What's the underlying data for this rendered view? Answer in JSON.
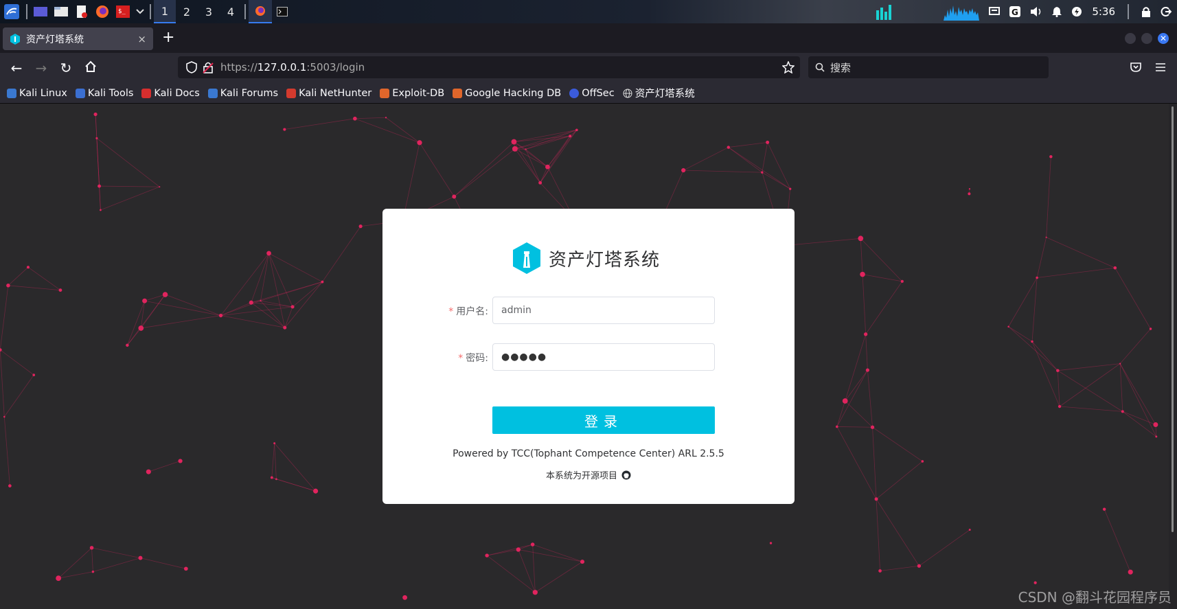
{
  "taskbar": {
    "workspaces": [
      "1",
      "2",
      "3",
      "4"
    ],
    "clock": "5:36"
  },
  "tab": {
    "title": "资产灯塔系统",
    "close": "×",
    "new_tab": "+"
  },
  "nav": {
    "url_prefix": "https://",
    "url_host": "127.0.0.1",
    "url_rest": ":5003/login",
    "search_placeholder": "搜索"
  },
  "bookmarks": [
    {
      "label": "Kali Linux",
      "color": "#3a78d0"
    },
    {
      "label": "Kali Tools",
      "color": "#3b6fd1"
    },
    {
      "label": "Kali Docs",
      "color": "#d62e2e"
    },
    {
      "label": "Kali Forums",
      "color": "#3a78d0"
    },
    {
      "label": "Kali NetHunter",
      "color": "#d33a2e"
    },
    {
      "label": "Exploit-DB",
      "color": "#e0662b"
    },
    {
      "label": "Google Hacking DB",
      "color": "#e0662b"
    },
    {
      "label": "OffSec",
      "color": "#3b5bdb"
    },
    {
      "label": "资产灯塔系统",
      "color": "#cccccc"
    }
  ],
  "login": {
    "brand_title": "资产灯塔系统",
    "username_label": "用户名:",
    "username_value": "admin",
    "password_label": "密码:",
    "password_value": "●●●●●",
    "required_mark": "*",
    "login_button": "登录",
    "powered_by": "Powered by TCC(Tophant Competence Center) ARL 2.5.5",
    "open_source": "本系统为开源项目"
  },
  "watermark": "CSDN @翻斗花园程序员",
  "colors": {
    "accent": "#00c0e0",
    "required": "#f56c6c",
    "particle": "#e0245e"
  }
}
